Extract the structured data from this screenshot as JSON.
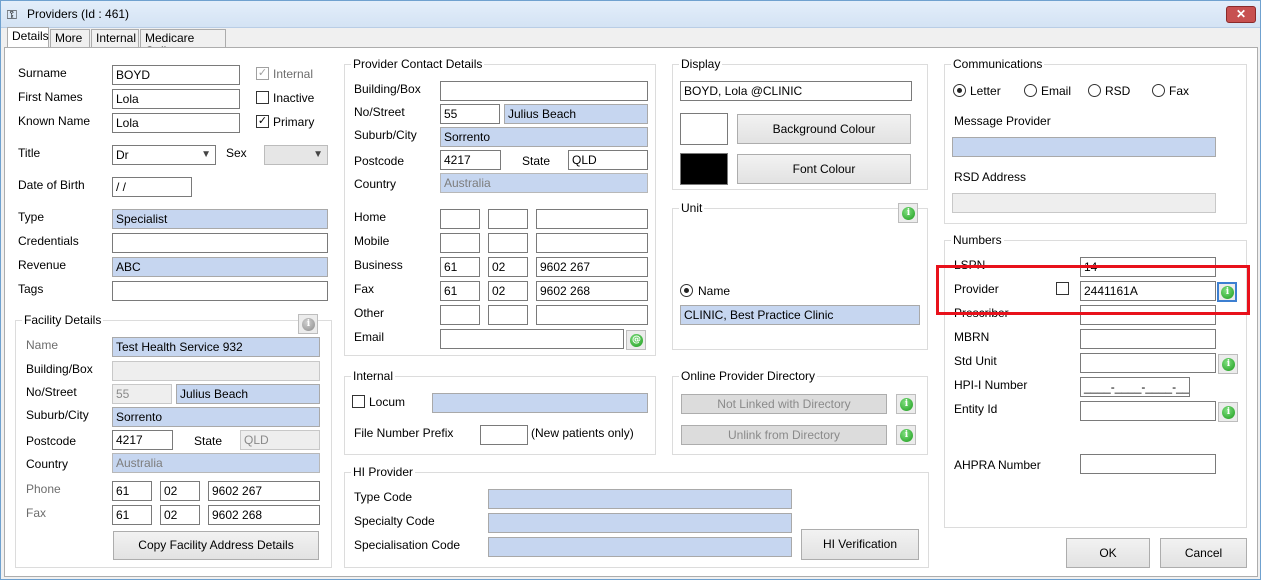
{
  "window": {
    "title": "Providers (Id : 461)",
    "icon": "key-icon",
    "close_label": "✕"
  },
  "tabs": [
    "Details",
    "More",
    "Internal",
    "Medicare Online"
  ],
  "personal": {
    "surname_label": "Surname",
    "surname": "BOYD",
    "first_names_label": "First Names",
    "first_names": "Lola",
    "known_name_label": "Known Name",
    "known_name": "Lola",
    "title_label": "Title",
    "title": "Dr",
    "sex_label": "Sex",
    "sex": "",
    "dob_label": "Date of Birth",
    "dob": " /  /",
    "type_label": "Type",
    "type": "Specialist",
    "credentials_label": "Credentials",
    "credentials": "",
    "revenue_label": "Revenue",
    "revenue": "ABC",
    "tags_label": "Tags",
    "tags": "",
    "internal_label": "Internal",
    "internal_checked": true,
    "inactive_label": "Inactive",
    "inactive_checked": false,
    "primary_label": "Primary",
    "primary_checked": true
  },
  "facility": {
    "group_title": "Facility Details",
    "name_label": "Name",
    "name": "Test Health Service 932",
    "building_label": "Building/Box",
    "building": "",
    "street_label": "No/Street",
    "street_no": "55",
    "street": "Julius Beach",
    "suburb_label": "Suburb/City",
    "suburb": "Sorrento",
    "postcode_label": "Postcode",
    "postcode": "4217",
    "state_label": "State",
    "state": "QLD",
    "country_label": "Country",
    "country": "Australia",
    "phone_label": "Phone",
    "phone": [
      "61",
      "02",
      "9602 267"
    ],
    "fax_label": "Fax",
    "fax": [
      "61",
      "02",
      "9602 268"
    ],
    "copy_button": "Copy Facility Address Details"
  },
  "contact": {
    "group_title": "Provider Contact Details",
    "building_label": "Building/Box",
    "building": "",
    "street_label": "No/Street",
    "street_no": "55",
    "street": "Julius Beach",
    "suburb_label": "Suburb/City",
    "suburb": "Sorrento",
    "postcode_label": "Postcode",
    "postcode": "4217",
    "state_label": "State",
    "state": "QLD",
    "country_label": "Country",
    "country": "Australia",
    "home_label": "Home",
    "home": [
      "",
      "",
      ""
    ],
    "mobile_label": "Mobile",
    "mobile": [
      "",
      "",
      ""
    ],
    "business_label": "Business",
    "business": [
      "61",
      "02",
      "9602 267"
    ],
    "fax_label": "Fax",
    "fax": [
      "61",
      "02",
      "9602 268"
    ],
    "other_label": "Other",
    "other": [
      "",
      "",
      ""
    ],
    "email_label": "Email",
    "email": "",
    "email_icon": "@"
  },
  "internal": {
    "group_title": "Internal",
    "locum_label": "Locum",
    "locum_checked": false,
    "locum": "",
    "file_prefix_label": "File Number Prefix",
    "file_prefix": "",
    "file_prefix_note": "(New patients only)"
  },
  "hi_provider": {
    "group_title": "HI Provider",
    "type_code_label": "Type Code",
    "specialty_code_label": "Specialty Code",
    "specialisation_code_label": "Specialisation Code",
    "verify_button": "HI Verification"
  },
  "display": {
    "group_title": "Display",
    "display_name": "BOYD, Lola @CLINIC",
    "background_button": "Background Colour",
    "font_button": "Font Colour",
    "background_color": "#ffffff",
    "font_color": "#000000"
  },
  "unit": {
    "group_title": "Unit",
    "name_label": "Name",
    "name": "CLINIC, Best Practice Clinic"
  },
  "directory": {
    "group_title": "Online Provider Directory",
    "not_linked_button": "Not Linked with Directory",
    "unlink_button": "Unlink from Directory"
  },
  "communications": {
    "group_title": "Communications",
    "options": [
      "Letter",
      "Email",
      "RSD",
      "Fax"
    ],
    "selected": "Letter",
    "message_provider_label": "Message Provider",
    "rsd_address_label": "RSD Address"
  },
  "numbers": {
    "group_title": "Numbers",
    "lspn_label": "LSPN",
    "lspn": "14",
    "provider_label": "Provider",
    "provider": "2441161A",
    "prescriber_label": "Prescriber",
    "prescriber": "",
    "mbrn_label": "MBRN",
    "mbrn": "",
    "std_unit_label": "Std Unit",
    "std_unit": "",
    "hpii_label": "HPI-I Number",
    "hpii": "____-____-____-____",
    "entity_label": "Entity Id",
    "entity": "",
    "ahpra_label": "AHPRA Number",
    "ahpra": ""
  },
  "footer": {
    "ok": "OK",
    "cancel": "Cancel"
  },
  "info_glyph": "i",
  "highlight_color": "#e8111b"
}
